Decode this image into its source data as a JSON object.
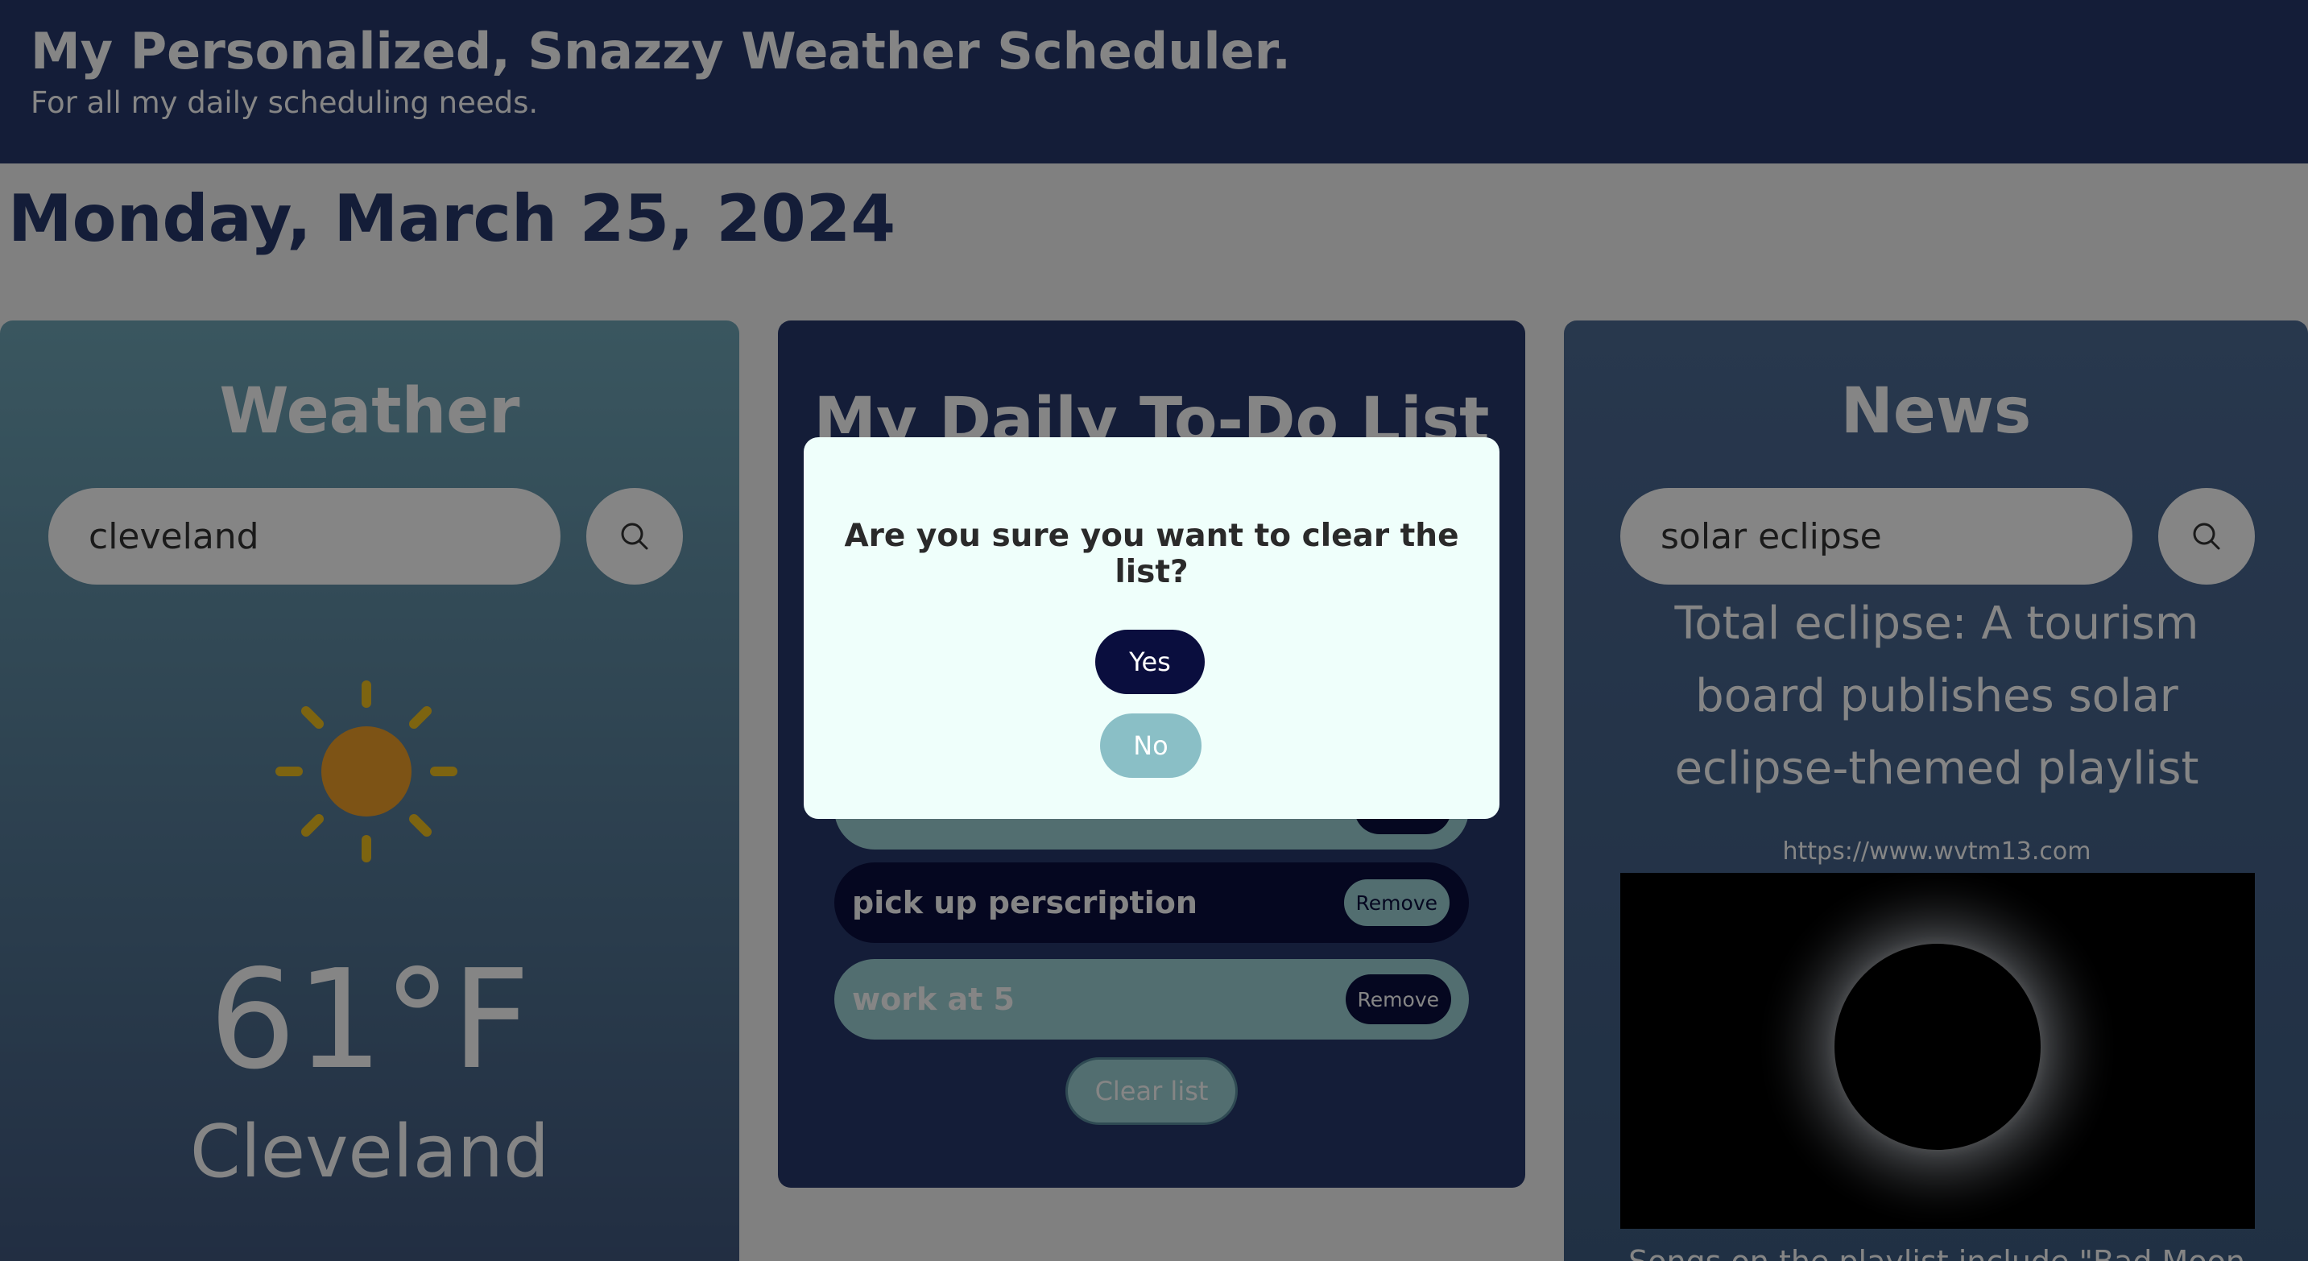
{
  "header": {
    "title": "My Personalized, Snazzy Weather Scheduler.",
    "subtitle": "For all my daily scheduling needs."
  },
  "date": "Monday, March 25, 2024",
  "weather": {
    "title": "Weather",
    "search_value": "cleveland",
    "search_icon": "search-icon",
    "condition_icon": "sun-icon",
    "temperature": "61°F",
    "city": "Cleveland"
  },
  "todo": {
    "title": "My Daily To-Do List",
    "items": [
      {
        "text": "pick up perscription",
        "remove_label": "Remove"
      },
      {
        "text": "work at 5",
        "remove_label": "Remove"
      }
    ],
    "clear_label": "Clear list"
  },
  "news": {
    "title": "News",
    "search_value": "solar eclipse",
    "search_icon": "search-icon",
    "headline": "Total eclipse: A tourism board publishes solar eclipse-themed playlist",
    "url": "https://www.wvtm13.com",
    "snippet": "Songs on the playlist include \"Bad Moon"
  },
  "modal": {
    "question": "Are you sure you want to clear the list?",
    "yes_label": "Yes",
    "no_label": "No"
  },
  "colors": {
    "header_bg": "#27386b",
    "dark_navy": "#0a0e3e",
    "teal": "#9ed4d6",
    "modal_bg": "#effffb",
    "sun": "#f0a02a",
    "sun_rays": "#f0c020"
  }
}
